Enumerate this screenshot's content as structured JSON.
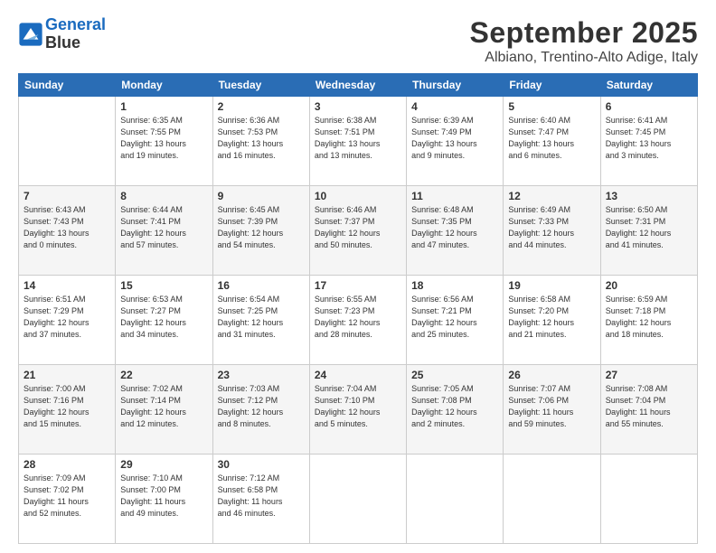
{
  "header": {
    "logo_line1": "General",
    "logo_line2": "Blue",
    "month": "September 2025",
    "location": "Albiano, Trentino-Alto Adige, Italy"
  },
  "weekdays": [
    "Sunday",
    "Monday",
    "Tuesday",
    "Wednesday",
    "Thursday",
    "Friday",
    "Saturday"
  ],
  "weeks": [
    [
      {
        "day": "",
        "info": ""
      },
      {
        "day": "1",
        "info": "Sunrise: 6:35 AM\nSunset: 7:55 PM\nDaylight: 13 hours\nand 19 minutes."
      },
      {
        "day": "2",
        "info": "Sunrise: 6:36 AM\nSunset: 7:53 PM\nDaylight: 13 hours\nand 16 minutes."
      },
      {
        "day": "3",
        "info": "Sunrise: 6:38 AM\nSunset: 7:51 PM\nDaylight: 13 hours\nand 13 minutes."
      },
      {
        "day": "4",
        "info": "Sunrise: 6:39 AM\nSunset: 7:49 PM\nDaylight: 13 hours\nand 9 minutes."
      },
      {
        "day": "5",
        "info": "Sunrise: 6:40 AM\nSunset: 7:47 PM\nDaylight: 13 hours\nand 6 minutes."
      },
      {
        "day": "6",
        "info": "Sunrise: 6:41 AM\nSunset: 7:45 PM\nDaylight: 13 hours\nand 3 minutes."
      }
    ],
    [
      {
        "day": "7",
        "info": "Sunrise: 6:43 AM\nSunset: 7:43 PM\nDaylight: 13 hours\nand 0 minutes."
      },
      {
        "day": "8",
        "info": "Sunrise: 6:44 AM\nSunset: 7:41 PM\nDaylight: 12 hours\nand 57 minutes."
      },
      {
        "day": "9",
        "info": "Sunrise: 6:45 AM\nSunset: 7:39 PM\nDaylight: 12 hours\nand 54 minutes."
      },
      {
        "day": "10",
        "info": "Sunrise: 6:46 AM\nSunset: 7:37 PM\nDaylight: 12 hours\nand 50 minutes."
      },
      {
        "day": "11",
        "info": "Sunrise: 6:48 AM\nSunset: 7:35 PM\nDaylight: 12 hours\nand 47 minutes."
      },
      {
        "day": "12",
        "info": "Sunrise: 6:49 AM\nSunset: 7:33 PM\nDaylight: 12 hours\nand 44 minutes."
      },
      {
        "day": "13",
        "info": "Sunrise: 6:50 AM\nSunset: 7:31 PM\nDaylight: 12 hours\nand 41 minutes."
      }
    ],
    [
      {
        "day": "14",
        "info": "Sunrise: 6:51 AM\nSunset: 7:29 PM\nDaylight: 12 hours\nand 37 minutes."
      },
      {
        "day": "15",
        "info": "Sunrise: 6:53 AM\nSunset: 7:27 PM\nDaylight: 12 hours\nand 34 minutes."
      },
      {
        "day": "16",
        "info": "Sunrise: 6:54 AM\nSunset: 7:25 PM\nDaylight: 12 hours\nand 31 minutes."
      },
      {
        "day": "17",
        "info": "Sunrise: 6:55 AM\nSunset: 7:23 PM\nDaylight: 12 hours\nand 28 minutes."
      },
      {
        "day": "18",
        "info": "Sunrise: 6:56 AM\nSunset: 7:21 PM\nDaylight: 12 hours\nand 25 minutes."
      },
      {
        "day": "19",
        "info": "Sunrise: 6:58 AM\nSunset: 7:20 PM\nDaylight: 12 hours\nand 21 minutes."
      },
      {
        "day": "20",
        "info": "Sunrise: 6:59 AM\nSunset: 7:18 PM\nDaylight: 12 hours\nand 18 minutes."
      }
    ],
    [
      {
        "day": "21",
        "info": "Sunrise: 7:00 AM\nSunset: 7:16 PM\nDaylight: 12 hours\nand 15 minutes."
      },
      {
        "day": "22",
        "info": "Sunrise: 7:02 AM\nSunset: 7:14 PM\nDaylight: 12 hours\nand 12 minutes."
      },
      {
        "day": "23",
        "info": "Sunrise: 7:03 AM\nSunset: 7:12 PM\nDaylight: 12 hours\nand 8 minutes."
      },
      {
        "day": "24",
        "info": "Sunrise: 7:04 AM\nSunset: 7:10 PM\nDaylight: 12 hours\nand 5 minutes."
      },
      {
        "day": "25",
        "info": "Sunrise: 7:05 AM\nSunset: 7:08 PM\nDaylight: 12 hours\nand 2 minutes."
      },
      {
        "day": "26",
        "info": "Sunrise: 7:07 AM\nSunset: 7:06 PM\nDaylight: 11 hours\nand 59 minutes."
      },
      {
        "day": "27",
        "info": "Sunrise: 7:08 AM\nSunset: 7:04 PM\nDaylight: 11 hours\nand 55 minutes."
      }
    ],
    [
      {
        "day": "28",
        "info": "Sunrise: 7:09 AM\nSunset: 7:02 PM\nDaylight: 11 hours\nand 52 minutes."
      },
      {
        "day": "29",
        "info": "Sunrise: 7:10 AM\nSunset: 7:00 PM\nDaylight: 11 hours\nand 49 minutes."
      },
      {
        "day": "30",
        "info": "Sunrise: 7:12 AM\nSunset: 6:58 PM\nDaylight: 11 hours\nand 46 minutes."
      },
      {
        "day": "",
        "info": ""
      },
      {
        "day": "",
        "info": ""
      },
      {
        "day": "",
        "info": ""
      },
      {
        "day": "",
        "info": ""
      }
    ]
  ]
}
